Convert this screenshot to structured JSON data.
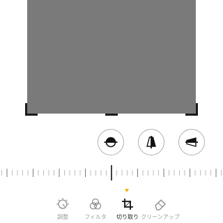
{
  "editor": {
    "tabs": [
      {
        "id": "adjust",
        "label": "調整",
        "icon": "adjust-dial-icon"
      },
      {
        "id": "filter",
        "label": "フィルタ",
        "icon": "filter-circles-icon"
      },
      {
        "id": "crop",
        "label": "切り取り",
        "icon": "crop-icon",
        "active": true
      },
      {
        "id": "cleanup",
        "label": "クリーンアップ",
        "icon": "eraser-icon"
      }
    ],
    "adjust_buttons": [
      {
        "id": "straighten",
        "icon": "straighten-icon"
      },
      {
        "id": "vertical",
        "icon": "vertical-perspective-icon"
      },
      {
        "id": "horizontal",
        "icon": "horizontal-perspective-icon"
      }
    ],
    "ruler": {
      "value": 0
    },
    "colors": {
      "accent": "#f2b300",
      "photo": "#7a7a7a",
      "tab_inactive": "#9a9a9a",
      "tab_active": "#222222"
    }
  }
}
